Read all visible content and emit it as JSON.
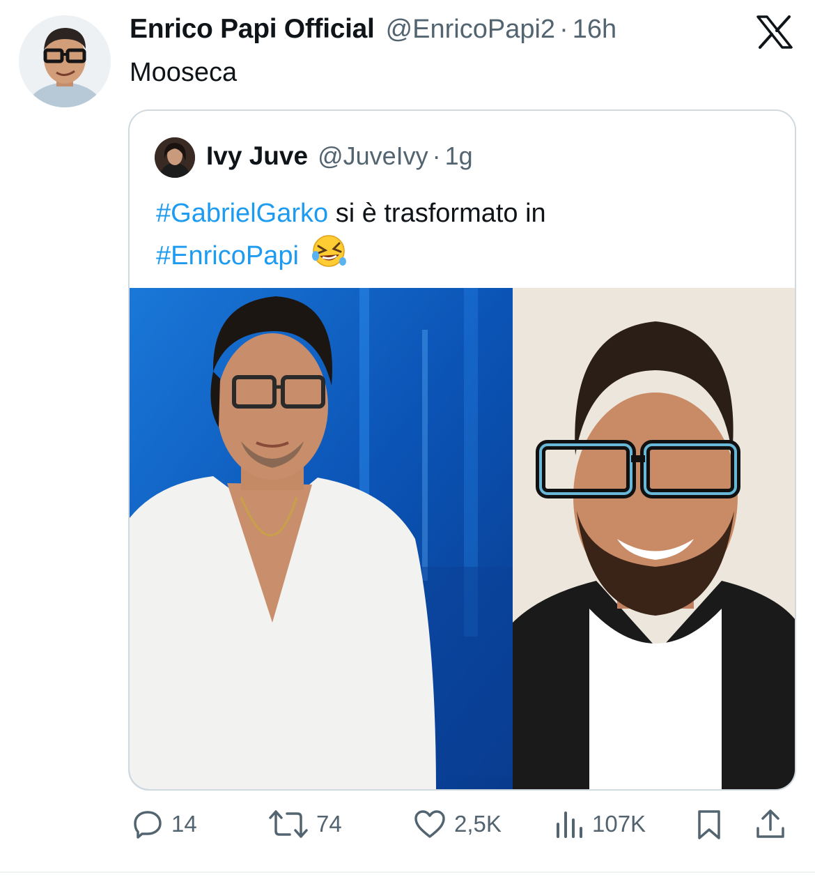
{
  "tweet": {
    "author_name": "Enrico Papi Official",
    "author_handle": "@EnricoPapi2",
    "separator": "·",
    "time": "16h",
    "text": "Mooseca"
  },
  "quoted_tweet": {
    "author_name": "Ivy Juve",
    "author_handle": "@JuveIvy",
    "separator": "·",
    "time": "1g",
    "hashtag_1": "#GabrielGarko",
    "text_middle": "si è trasformato in",
    "hashtag_2": "#EnricoPapi",
    "emoji": "🤣"
  },
  "actions": {
    "replies": "14",
    "reposts": "74",
    "likes": "2,5K",
    "views": "107K"
  },
  "colors": {
    "link": "#1d9bf0",
    "secondary_text": "#536471",
    "border": "#cfd9de"
  },
  "icons": [
    "x-logo-icon",
    "reply-icon",
    "repost-icon",
    "like-icon",
    "views-icon",
    "bookmark-icon",
    "share-icon"
  ]
}
